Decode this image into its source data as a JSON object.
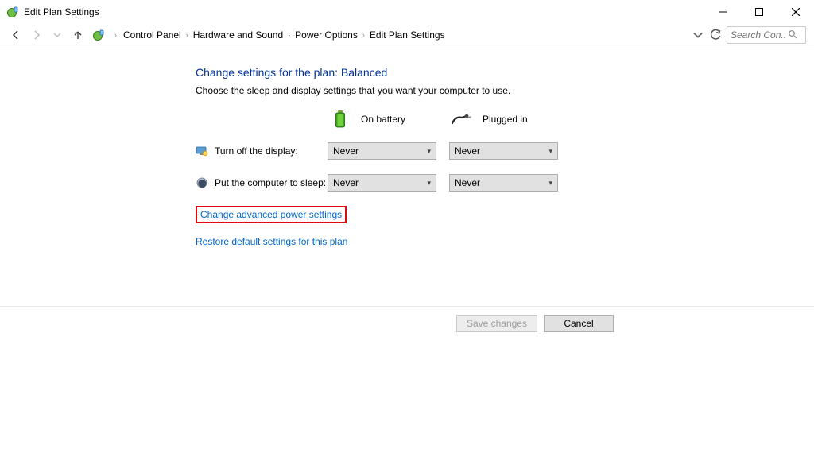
{
  "window": {
    "title": "Edit Plan Settings"
  },
  "breadcrumbs": {
    "items": [
      "Control Panel",
      "Hardware and Sound",
      "Power Options",
      "Edit Plan Settings"
    ]
  },
  "search": {
    "placeholder": "Search Con..."
  },
  "heading": "Change settings for the plan: Balanced",
  "subtext": "Choose the sleep and display settings that you want your computer to use.",
  "columns": {
    "battery": "On battery",
    "plugged": "Plugged in"
  },
  "settings": {
    "display": {
      "label": "Turn off the display:",
      "battery_value": "Never",
      "plugged_value": "Never"
    },
    "sleep": {
      "label": "Put the computer to sleep:",
      "battery_value": "Never",
      "plugged_value": "Never"
    }
  },
  "links": {
    "advanced": "Change advanced power settings",
    "restore": "Restore default settings for this plan"
  },
  "buttons": {
    "save": "Save changes",
    "cancel": "Cancel"
  }
}
